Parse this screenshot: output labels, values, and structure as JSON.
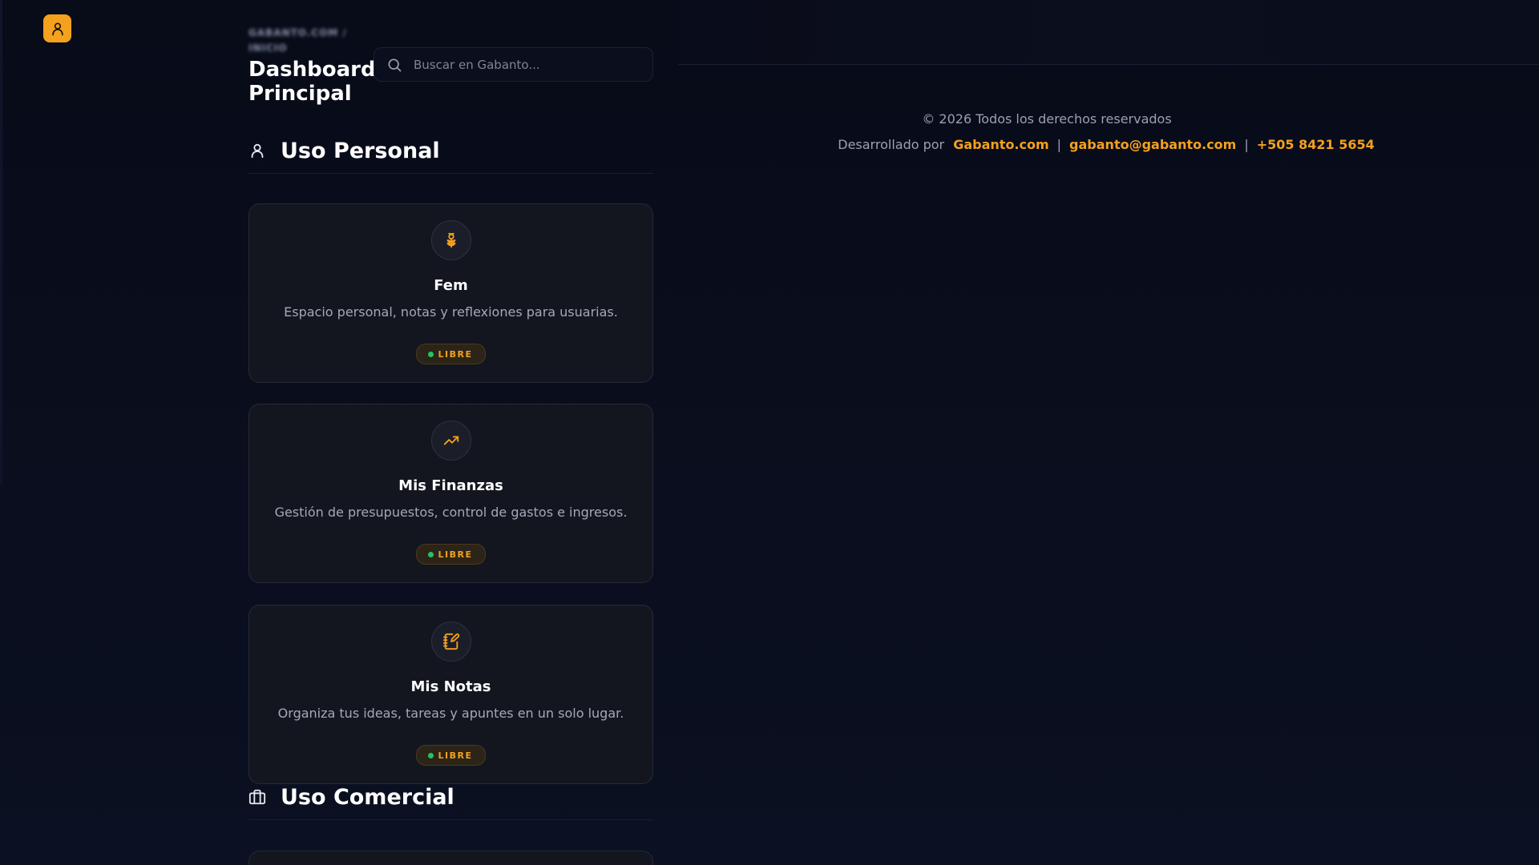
{
  "header": {
    "breadcrumb": "GABANTO.COM / INICIO",
    "title": "Dashboard Principal",
    "user_icon": "user-icon"
  },
  "search": {
    "placeholder": "Buscar en Gabanto...",
    "value": "",
    "icon": "search-icon"
  },
  "footer": {
    "copyright": "© 2026 Todos los derechos reservados",
    "developed_by": "Desarrollado por",
    "site": "Gabanto.com",
    "email": "gabanto@gabanto.com",
    "phone": "+505 8421 5654",
    "separator": "|"
  },
  "sections": [
    {
      "title": "Uso Personal",
      "icon": "user-icon",
      "cards": [
        {
          "title": "Fem",
          "description": "Espacio personal, notas y reflexiones para usuarias.",
          "icon": "flower-icon",
          "badge": "LIBRE"
        },
        {
          "title": "Mis Finanzas",
          "description": "Gestión de presupuestos, control de gastos e ingresos.",
          "icon": "trending-up-icon",
          "badge": "LIBRE"
        },
        {
          "title": "Mis Notas",
          "description": "Organiza tus ideas, tareas y apuntes en un solo lugar.",
          "icon": "notebook-pen-icon",
          "badge": "LIBRE"
        }
      ]
    },
    {
      "title": "Uso Comercial",
      "icon": "briefcase-icon",
      "cards": []
    }
  ],
  "colors": {
    "accent": "#f4a11d",
    "background": "#090c1a",
    "card": "#13161f",
    "status_dot": "#22c55e"
  }
}
